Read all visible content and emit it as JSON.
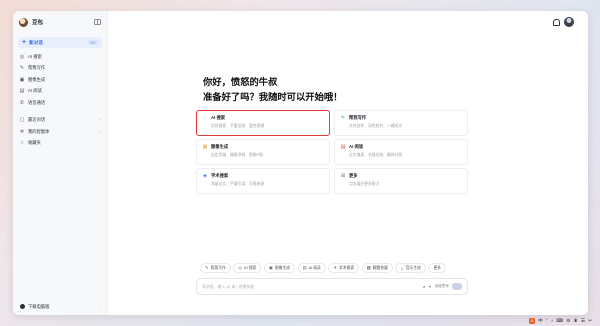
{
  "sidebar": {
    "app_name": "豆包",
    "new_chat": {
      "label": "新对话",
      "shortcut": "⌘K"
    },
    "items": [
      {
        "label": "AI 搜索",
        "icon": "search-icon",
        "glyph": "◎"
      },
      {
        "label": "帮我写作",
        "icon": "pen-icon",
        "glyph": "✎"
      },
      {
        "label": "图像生成",
        "icon": "image-icon",
        "glyph": "▣"
      },
      {
        "label": "AI 阅读",
        "icon": "read-icon",
        "glyph": "▤"
      },
      {
        "label": "语音通话",
        "icon": "phone-icon",
        "glyph": "✆"
      }
    ],
    "items2": [
      {
        "label": "最近对话",
        "icon": "chat-icon",
        "glyph": "▢",
        "arrow": "›"
      },
      {
        "label": "我的智能体",
        "icon": "agent-icon",
        "glyph": "✲",
        "arrow": "›"
      },
      {
        "label": "收藏夹",
        "icon": "bookmark-icon",
        "glyph": "☆",
        "arrow": ""
      }
    ],
    "download": {
      "label": "下载电脑版",
      "arrow": "›"
    }
  },
  "main": {
    "greeting_line1": "你好，愤怒的牛叔",
    "greeting_line2": "准备好了吗？我随时可以开始哦！",
    "cards": [
      {
        "title": "AI 搜索",
        "desc": "实时搜索、不重信源、整合逻辑",
        "icon": "search-icon",
        "glyph": "◌",
        "color": "#3b6ef0"
      },
      {
        "title": "帮我写作",
        "desc": "文档创作、润色校对、一键成文",
        "icon": "pen-icon",
        "glyph": "✎",
        "color": "#2fb36a"
      },
      {
        "title": "图像生成",
        "desc": "自定风格、随意涂鸦、智能P图",
        "icon": "image-icon",
        "glyph": "▦",
        "color": "#e8a23a"
      },
      {
        "title": "AI 阅读",
        "desc": "论文速读、长链总结、翻译对照",
        "icon": "read-icon",
        "glyph": "▤",
        "color": "#e0443c"
      },
      {
        "title": "学术搜索",
        "desc": "海量论文、严谨引用、可靠来源",
        "icon": "academic-icon",
        "glyph": "◈",
        "color": "#3b6ef0"
      },
      {
        "title": "更多",
        "desc": "点击展开更多能力",
        "icon": "more-icon",
        "glyph": "⊞",
        "color": "#8a8f99"
      }
    ],
    "chips": [
      {
        "label": "帮我写作",
        "glyph": "✎",
        "icon": "pen-icon"
      },
      {
        "label": "AI 搜索",
        "glyph": "◎",
        "icon": "search-icon"
      },
      {
        "label": "图像生成",
        "glyph": "▣",
        "icon": "image-icon"
      },
      {
        "label": "AI 阅读",
        "glyph": "▤",
        "icon": "read-icon"
      },
      {
        "label": "学术搜索",
        "glyph": "✈",
        "icon": "academic-icon"
      },
      {
        "label": "解题答疑",
        "glyph": "▦",
        "icon": "solve-icon"
      },
      {
        "label": "音乐生成",
        "glyph": "♫",
        "icon": "music-icon"
      },
      {
        "label": "更多",
        "glyph": "",
        "icon": "more-icon"
      }
    ],
    "input": {
      "placeholder": "发消息、输入 @ 或 / 选择技能",
      "tool_label": "深度思考",
      "attach_glyph": "⌀",
      "deep_glyph": "✦"
    }
  },
  "tray": [
    "S",
    "中",
    "°",
    "♪",
    "⌨",
    "⚙",
    "♜",
    "☰",
    "✂"
  ]
}
